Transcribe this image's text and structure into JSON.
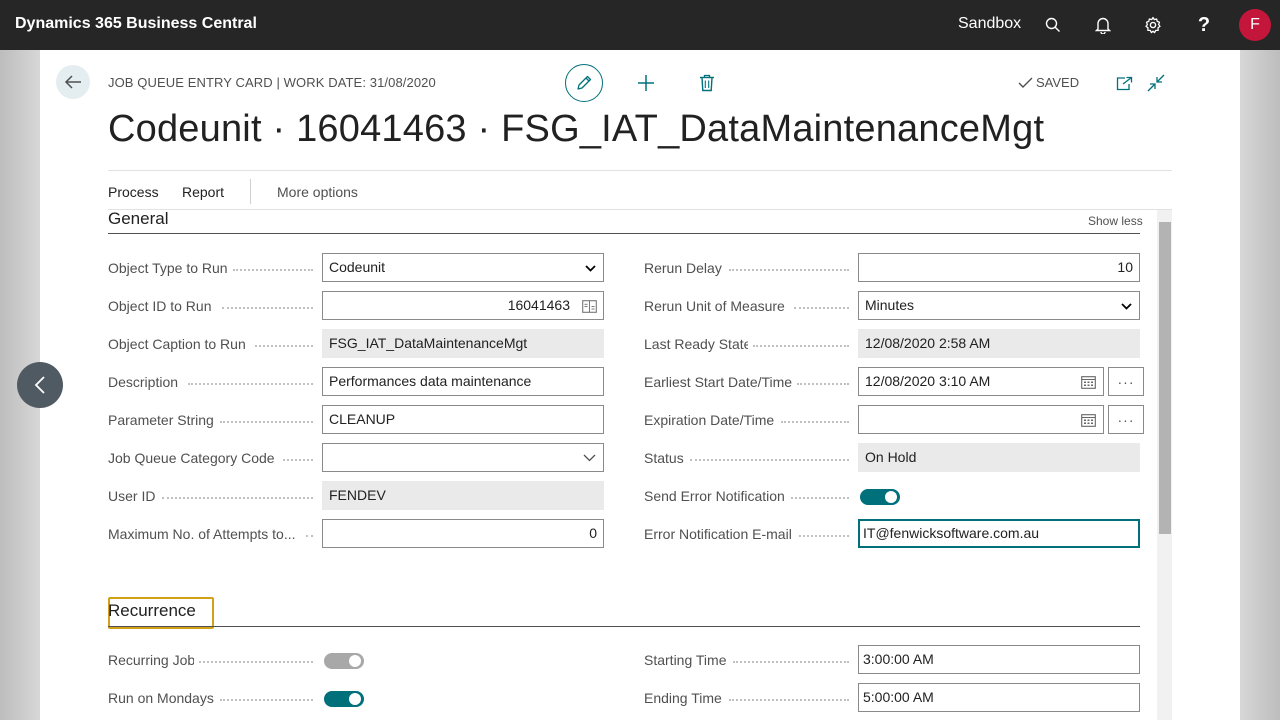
{
  "app": {
    "title": "Dynamics 365 Business Central",
    "environment": "Sandbox",
    "user_initial": "F",
    "avatar_color": "#c4163b"
  },
  "header": {
    "breadcrumb": "JOB QUEUE ENTRY CARD | WORK DATE: 31/08/2020",
    "status": "SAVED",
    "title": "Codeunit · 16041463 · FSG_IAT_DataMaintenanceMgt"
  },
  "actions": {
    "process": "Process",
    "report": "Report",
    "more": "More options"
  },
  "general": {
    "title": "General",
    "show_less": "Show less",
    "left": [
      {
        "label": "Object Type to Run",
        "value": "Codeunit"
      },
      {
        "label": "Object ID to Run",
        "value": "16041463"
      },
      {
        "label": "Object Caption to Run",
        "value": "FSG_IAT_DataMaintenanceMgt"
      },
      {
        "label": "Description",
        "value": "Performances data maintenance"
      },
      {
        "label": "Parameter String",
        "value": "CLEANUP"
      },
      {
        "label": "Job Queue Category Code",
        "value": ""
      },
      {
        "label": "User ID",
        "value": "FENDEV"
      },
      {
        "label": "Maximum No. of Attempts to...",
        "value": "0"
      }
    ],
    "right": [
      {
        "label": "Rerun Delay",
        "value": "10"
      },
      {
        "label": "Rerun Unit of Measure",
        "value": "Minutes"
      },
      {
        "label": "Last Ready State",
        "value": "12/08/2020 2:58 AM"
      },
      {
        "label": "Earliest Start Date/Time",
        "value": "12/08/2020 3:10 AM"
      },
      {
        "label": "Expiration Date/Time",
        "value": ""
      },
      {
        "label": "Status",
        "value": "On Hold"
      },
      {
        "label": "Send Error Notification",
        "value": true
      },
      {
        "label": "Error Notification E-mail",
        "value": "IT@fenwicksoftware.com.au"
      }
    ]
  },
  "recurrence": {
    "title": "Recurrence",
    "left": [
      {
        "label": "Recurring Job",
        "value": true
      },
      {
        "label": "Run on Mondays",
        "value": true
      }
    ],
    "right": [
      {
        "label": "Starting Time",
        "value": "3:00:00 AM"
      },
      {
        "label": "Ending Time",
        "value": "5:00:00 AM"
      }
    ]
  },
  "colors": {
    "accent": "#00707b",
    "topbar": "#262626",
    "focus_outline": "#d4a017"
  }
}
